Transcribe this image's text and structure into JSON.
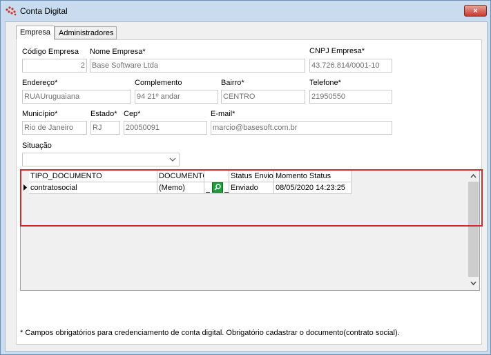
{
  "window": {
    "title": "Conta Digital",
    "close_label": "×"
  },
  "tabs": [
    {
      "label": "Empresa",
      "active": true
    },
    {
      "label": "Administradores",
      "active": false
    }
  ],
  "form": {
    "codigo": {
      "label": "Código Empresa",
      "value": "2"
    },
    "nome": {
      "label": "Nome Empresa*",
      "value": "Base Software Ltda"
    },
    "cnpj": {
      "label": "CNPJ Empresa*",
      "value": "43.726.814/0001-10"
    },
    "endereco": {
      "label": "Endereço*",
      "value": "RUAUruguaiana"
    },
    "complemento": {
      "label": "Complemento",
      "value": "94 21º andar"
    },
    "bairro": {
      "label": "Bairro*",
      "value": "CENTRO"
    },
    "telefone": {
      "label": "Telefone*",
      "value": "21950550"
    },
    "municipio": {
      "label": "Município*",
      "value": "Rio de Janeiro"
    },
    "estado": {
      "label": "Estado*",
      "value": "RJ"
    },
    "cep": {
      "label": "Cep*",
      "value": "20050091"
    },
    "email": {
      "label": "E-mail*",
      "value": "marcio@basesoft.com.br"
    },
    "situacao": {
      "label": "Situação",
      "value": ""
    }
  },
  "grid": {
    "columns": [
      "TIPO_DOCUMENTO",
      "DOCUMENTO",
      "",
      "Status Envio",
      "Momento Status"
    ],
    "rows": [
      {
        "tipo": "contratosocial",
        "documento": "(Memo)",
        "status": "Enviado",
        "momento": "08/05/2020 14:23:25"
      }
    ]
  },
  "footnote": "* Campos obrigatórios para credenciamento de conta digital. Obrigatório cadastrar o documento(contrato social).",
  "icons": {
    "app": "app-logo-icon",
    "close": "close-icon",
    "chevron": "chevron-down-icon",
    "search": "search-icon",
    "row_indicator": "row-pointer-icon"
  },
  "colors": {
    "highlight": "#d62828",
    "close": "#c8392b",
    "memo_button": "#1c9c3b"
  }
}
